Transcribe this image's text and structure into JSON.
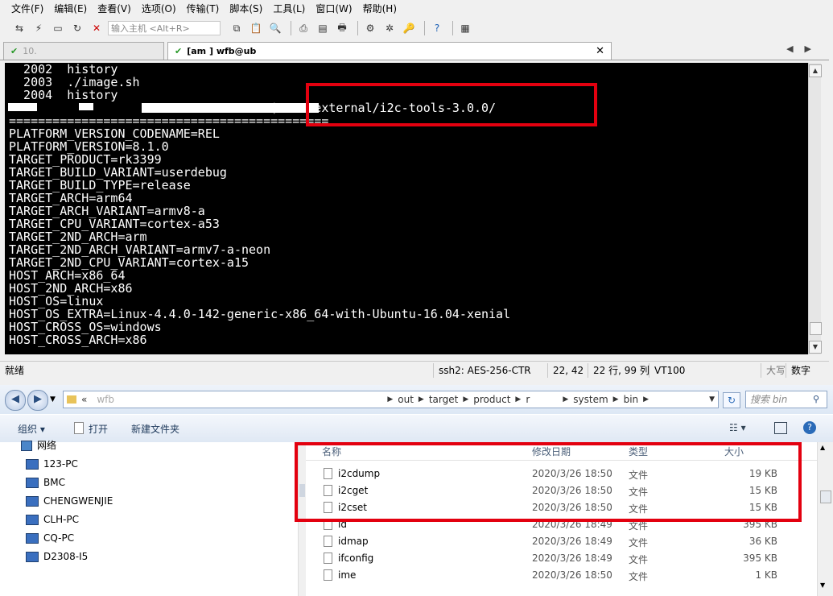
{
  "menu": [
    "文件(F)",
    "编辑(E)",
    "查看(V)",
    "选项(O)",
    "传输(T)",
    "脚本(S)",
    "工具(L)",
    "窗口(W)",
    "帮助(H)"
  ],
  "toolbar": {
    "host_placeholder": "输入主机 <Alt+R>"
  },
  "tabs": {
    "tab1": "10.          ",
    "tab2": "[am               ]  wfb@ub       "
  },
  "terminal": {
    "lines": [
      "  2002  history",
      "  2003  ./image.sh",
      "  2004  history",
      "                                    $ mmm external/i2c-tools-3.0.0/",
      "============================================",
      "PLATFORM_VERSION_CODENAME=REL",
      "PLATFORM_VERSION=8.1.0",
      "TARGET_PRODUCT=rk3399",
      "TARGET_BUILD_VARIANT=userdebug",
      "TARGET_BUILD_TYPE=release",
      "TARGET_ARCH=arm64",
      "TARGET_ARCH_VARIANT=armv8-a",
      "TARGET_CPU_VARIANT=cortex-a53",
      "TARGET_2ND_ARCH=arm",
      "TARGET_2ND_ARCH_VARIANT=armv7-a-neon",
      "TARGET_2ND_CPU_VARIANT=cortex-a15",
      "HOST_ARCH=x86_64",
      "HOST_2ND_ARCH=x86",
      "HOST_OS=linux",
      "HOST_OS_EXTRA=Linux-4.4.0-142-generic-x86_64-with-Ubuntu-16.04-xenial",
      "HOST_CROSS_OS=windows",
      "HOST_CROSS_ARCH=x86"
    ]
  },
  "status": {
    "ready": "就绪",
    "cipher": "ssh2: AES-256-CTR",
    "cursor": "22, 42",
    "rowscols": "22 行, 99 列",
    "term": "VT100",
    "caps": "大写",
    "num": "数字"
  },
  "explorer": {
    "crumbs": [
      "«",
      "wfb",
      "out",
      "target",
      "product",
      "r",
      "system",
      "bin"
    ],
    "search_placeholder": "搜索 bin",
    "commands": {
      "organize": "组织 ▾",
      "open": "打开",
      "new_folder": "新建文件夹"
    },
    "nav": {
      "network": "网络",
      "pcs": [
        "123-PC",
        "BMC",
        "CHENGWENJIE",
        "CLH-PC",
        "CQ-PC",
        "D2308-I5"
      ]
    },
    "columns": {
      "name": "名称",
      "date": "修改日期",
      "type": "类型",
      "size": "大小"
    },
    "files": [
      {
        "name": "i2cdump",
        "date": "2020/3/26 18:50",
        "type": "文件",
        "size": "19 KB"
      },
      {
        "name": "i2cget",
        "date": "2020/3/26 18:50",
        "type": "文件",
        "size": "15 KB"
      },
      {
        "name": "i2cset",
        "date": "2020/3/26 18:50",
        "type": "文件",
        "size": "15 KB"
      },
      {
        "name": "id",
        "date": "2020/3/26 18:49",
        "type": "文件",
        "size": "395 KB"
      },
      {
        "name": "idmap",
        "date": "2020/3/26 18:49",
        "type": "文件",
        "size": "36 KB"
      },
      {
        "name": "ifconfig",
        "date": "2020/3/26 18:49",
        "type": "文件",
        "size": "395 KB"
      },
      {
        "name": "ime",
        "date": "2020/3/26 18:50",
        "type": "文件",
        "size": "1 KB"
      }
    ]
  },
  "colors": {
    "terminal_bg": "#000000",
    "terminal_fg": "#ffffff",
    "highlight": "#e3000f"
  }
}
